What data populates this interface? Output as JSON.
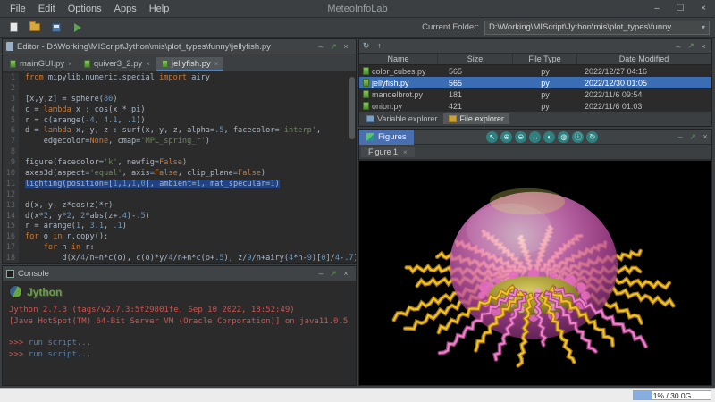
{
  "titlebar": {
    "title": "MeteoInfoLab",
    "menus": [
      "File",
      "Edit",
      "Options",
      "Apps",
      "Help"
    ],
    "window_controls": [
      {
        "name": "minimize-icon",
        "glyph": "–"
      },
      {
        "name": "maximize-icon",
        "glyph": "☐"
      },
      {
        "name": "close-icon",
        "glyph": "×"
      }
    ]
  },
  "toolbar": {
    "buttons": [
      {
        "name": "new-script-button",
        "icon": "new-file-icon"
      },
      {
        "name": "open-file-button",
        "icon": "open-folder-icon"
      },
      {
        "name": "save-button",
        "icon": "save-icon"
      },
      {
        "name": "run-script-button",
        "icon": "run-icon"
      }
    ],
    "current_folder_label": "Current Folder:",
    "current_folder_value": "D:\\Working\\MIScript\\Jython\\mis\\plot_types\\funny"
  },
  "panel_controls": [
    {
      "name": "minimize-icon",
      "glyph": "–"
    },
    {
      "name": "float-icon",
      "glyph": "↗"
    },
    {
      "name": "close-icon",
      "glyph": "×"
    }
  ],
  "editor": {
    "title": "Editor - D:\\Working\\MIScript\\Jython\\mis\\plot_types\\funny\\jellyfish.py",
    "tabs": [
      {
        "label": "mainGUI.py",
        "active": false
      },
      {
        "label": "quiver3_2.py",
        "active": false
      },
      {
        "label": "jellyfish.py",
        "active": true
      }
    ],
    "active_line": 11,
    "code_lines": [
      [
        [
          "kw",
          "from"
        ],
        [
          "txt",
          " mipylib.numeric.special "
        ],
        [
          "kw",
          "import"
        ],
        [
          "txt",
          " airy"
        ]
      ],
      [],
      [
        [
          "txt",
          "[x,y,z] = sphere("
        ],
        [
          "num",
          "80"
        ],
        [
          "txt",
          ")"
        ]
      ],
      [
        [
          "txt",
          "c = "
        ],
        [
          "kw",
          "lambda"
        ],
        [
          "txt",
          " x : cos(x * pi)"
        ]
      ],
      [
        [
          "txt",
          "r = c(arange("
        ],
        [
          "num",
          "-4"
        ],
        [
          "txt",
          ", "
        ],
        [
          "num",
          "4.1"
        ],
        [
          "txt",
          ", "
        ],
        [
          "num",
          ".1"
        ],
        [
          "txt",
          "))"
        ]
      ],
      [
        [
          "txt",
          "d = "
        ],
        [
          "kw",
          "lambda"
        ],
        [
          "txt",
          " x, y, z : surf(x, y, z, alpha="
        ],
        [
          "num",
          ".5"
        ],
        [
          "txt",
          ", facecolor="
        ],
        [
          "str",
          "'interp'"
        ],
        [
          "txt",
          ","
        ]
      ],
      [
        [
          "txt",
          "    edgecolor="
        ],
        [
          "kw",
          "None"
        ],
        [
          "txt",
          ", cmap="
        ],
        [
          "str",
          "'MPL_spring_r'"
        ],
        [
          "txt",
          ")"
        ]
      ],
      [],
      [
        [
          "txt",
          "figure(facecolor="
        ],
        [
          "str",
          "'k'"
        ],
        [
          "txt",
          ", newfig="
        ],
        [
          "kw",
          "False"
        ],
        [
          "txt",
          ")"
        ]
      ],
      [
        [
          "txt",
          "axes3d(aspect="
        ],
        [
          "str",
          "'equal'"
        ],
        [
          "txt",
          ", axis="
        ],
        [
          "kw",
          "False"
        ],
        [
          "txt",
          ", clip_plane="
        ],
        [
          "kw",
          "False"
        ],
        [
          "txt",
          ")"
        ]
      ],
      [
        [
          "txt",
          "lighting(position=["
        ],
        [
          "num",
          "1"
        ],
        [
          "txt",
          ","
        ],
        [
          "num",
          "1"
        ],
        [
          "txt",
          ","
        ],
        [
          "num",
          "1"
        ],
        [
          "txt",
          ","
        ],
        [
          "num",
          "0"
        ],
        [
          "txt",
          "], ambient="
        ],
        [
          "num",
          "1"
        ],
        [
          "txt",
          ", mat_specular="
        ],
        [
          "num",
          "1"
        ],
        [
          "txt",
          ")"
        ]
      ],
      [],
      [
        [
          "txt",
          "d(x, y, z*cos(z)*r)"
        ]
      ],
      [
        [
          "txt",
          "d(x*"
        ],
        [
          "num",
          "2"
        ],
        [
          "txt",
          ", y*"
        ],
        [
          "num",
          "2"
        ],
        [
          "txt",
          ", "
        ],
        [
          "num",
          "2"
        ],
        [
          "txt",
          "*abs(z+"
        ],
        [
          "num",
          ".4"
        ],
        [
          "txt",
          ")-"
        ],
        [
          "num",
          ".5"
        ],
        [
          "txt",
          ")"
        ]
      ],
      [
        [
          "txt",
          "r = arange("
        ],
        [
          "num",
          "1"
        ],
        [
          "txt",
          ", "
        ],
        [
          "num",
          "3.1"
        ],
        [
          "txt",
          ", "
        ],
        [
          "num",
          ".1"
        ],
        [
          "txt",
          ")"
        ]
      ],
      [
        [
          "kw",
          "for"
        ],
        [
          "txt",
          " o "
        ],
        [
          "kw",
          "in"
        ],
        [
          "txt",
          " r.copy():"
        ]
      ],
      [
        [
          "txt",
          "    "
        ],
        [
          "kw",
          "for"
        ],
        [
          "txt",
          " n "
        ],
        [
          "kw",
          "in"
        ],
        [
          "txt",
          " r:"
        ]
      ],
      [
        [
          "txt",
          "        d(x/"
        ],
        [
          "num",
          "4"
        ],
        [
          "txt",
          "/n+n*c(o), c(o)*y/"
        ],
        [
          "num",
          "4"
        ],
        [
          "txt",
          "/n+n*c(o+"
        ],
        [
          "num",
          ".5"
        ],
        [
          "txt",
          "), z/"
        ],
        [
          "num",
          "9"
        ],
        [
          "txt",
          "/n+airy("
        ],
        [
          "num",
          "4"
        ],
        [
          "txt",
          "*n-"
        ],
        [
          "num",
          "9"
        ],
        [
          "txt",
          ")["
        ],
        [
          "num",
          "0"
        ],
        [
          "txt",
          "]/"
        ],
        [
          "num",
          "4"
        ],
        [
          "txt",
          "-"
        ],
        [
          "num",
          ".7"
        ],
        [
          "txt",
          ")"
        ]
      ]
    ]
  },
  "console": {
    "title": "Console",
    "logo_text": "Jython",
    "lines": [
      {
        "type": "info",
        "text": "Jython 2.7.3 (tags/v2.7.3:5f29801fe, Sep 10 2022, 18:52:49)"
      },
      {
        "type": "info",
        "text": "[Java HotSpot(TM) 64-Bit Server VM (Oracle Corporation)] on java11.0.5"
      },
      {
        "type": "command",
        "prompt": ">>> ",
        "text": "run script..."
      },
      {
        "type": "command",
        "prompt": ">>> ",
        "text": "run script..."
      }
    ]
  },
  "file_explorer": {
    "tools": [
      {
        "name": "refresh-icon",
        "glyph": "↻"
      },
      {
        "name": "parent-folder-icon",
        "glyph": "↑"
      }
    ],
    "columns": [
      "Name",
      "Size",
      "File Type",
      "Date Modified"
    ],
    "rows": [
      {
        "name": "color_cubes.py",
        "size": "565",
        "type": "py",
        "modified": "2022/12/27 04:16",
        "selected": false
      },
      {
        "name": "jellyfish.py",
        "size": "565",
        "type": "py",
        "modified": "2022/12/30 01:05",
        "selected": true
      },
      {
        "name": "mandelbrot.py",
        "size": "181",
        "type": "py",
        "modified": "2022/11/6 09:54",
        "selected": false
      },
      {
        "name": "onion.py",
        "size": "421",
        "type": "py",
        "modified": "2022/11/6 01:03",
        "selected": false
      }
    ],
    "bottom_tabs": [
      {
        "label": "Variable explorer",
        "icon": "table-icon",
        "active": false
      },
      {
        "label": "File explorer",
        "icon": "folder-icon",
        "active": true
      }
    ]
  },
  "figures": {
    "title": "Figures",
    "tools": [
      {
        "name": "cursor-icon",
        "glyph": "↖"
      },
      {
        "name": "zoom-in-icon",
        "glyph": "⊕"
      },
      {
        "name": "zoom-out-icon",
        "glyph": "⊖"
      },
      {
        "name": "pan-icon",
        "glyph": "↔"
      },
      {
        "name": "globe-icon",
        "glyph": "◐"
      },
      {
        "name": "globe-grid-icon",
        "glyph": "◍"
      },
      {
        "name": "info-icon",
        "glyph": "ⓘ"
      },
      {
        "name": "rotate-icon",
        "glyph": "↻"
      }
    ],
    "tabs": [
      {
        "label": "Figure 1",
        "active": true
      }
    ]
  },
  "statusbar": {
    "memory": "1% / 30.0G"
  },
  "colors": {
    "selection_blue": "#3a6db3",
    "keyword_orange": "#cc7832",
    "string_green": "#6a8759",
    "number_blue": "#6897bb",
    "console_red": "#d25252",
    "run_green": "#57a64a"
  }
}
